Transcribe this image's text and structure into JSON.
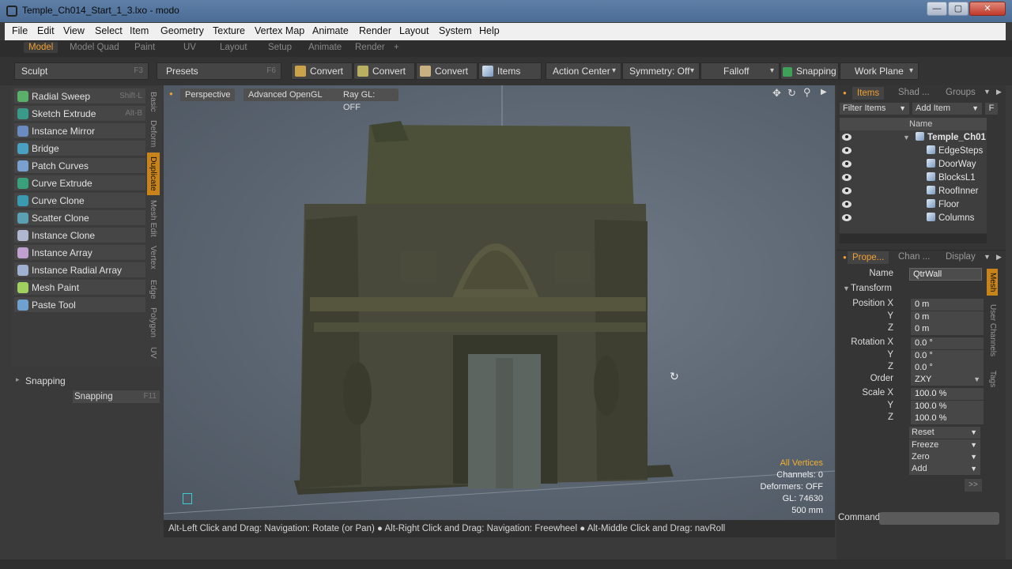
{
  "window": {
    "title": "Temple_Ch014_Start_1_3.lxo - modo",
    "minimize": "—",
    "maximize": "▢",
    "close": "✕"
  },
  "menu": [
    "File",
    "Edit",
    "View",
    "Select",
    "Item",
    "Geometry",
    "Texture",
    "Vertex Map",
    "Animate",
    "Render",
    "Layout",
    "System",
    "Help"
  ],
  "layout_tabs": [
    "Model",
    "Model Quad",
    "Paint",
    "UV",
    "Layout",
    "Setup",
    "Animate",
    "Render",
    "+"
  ],
  "toolbar": {
    "sculpt": {
      "label": "Sculpt",
      "shortcut": "F3"
    },
    "presets": {
      "label": "Presets",
      "shortcut": "F6"
    },
    "convert": [
      "Convert",
      "Convert",
      "Convert"
    ],
    "items": "Items",
    "action_center": "Action Center",
    "symmetry": "Symmetry: Off",
    "falloff": "Falloff",
    "snapping": "Snapping",
    "work_plane": "Work Plane"
  },
  "tools": [
    {
      "label": "Radial Sweep",
      "shortcut": "Shift-L"
    },
    {
      "label": "Sketch Extrude",
      "shortcut": "Alt-B"
    },
    {
      "label": "Instance Mirror",
      "shortcut": ""
    },
    {
      "label": "Bridge",
      "shortcut": ""
    },
    {
      "label": "Patch Curves",
      "shortcut": ""
    },
    {
      "label": "Curve Extrude",
      "shortcut": ""
    },
    {
      "label": "Curve Clone",
      "shortcut": ""
    },
    {
      "label": "Scatter Clone",
      "shortcut": ""
    },
    {
      "label": "Instance Clone",
      "shortcut": ""
    },
    {
      "label": "Instance Array",
      "shortcut": ""
    },
    {
      "label": "Instance Radial Array",
      "shortcut": ""
    },
    {
      "label": "Mesh Paint",
      "shortcut": ""
    },
    {
      "label": "Paste Tool",
      "shortcut": ""
    }
  ],
  "vertical_tabs": [
    "Basic",
    "Deform",
    "Duplicate",
    "Mesh Edit",
    "Vertex",
    "Edge",
    "Polygon",
    "UV"
  ],
  "snapping_section": {
    "title": "Snapping",
    "button": "Snapping",
    "shortcut": "F11"
  },
  "viewport": {
    "perspective": "Perspective",
    "renderer": "Advanced OpenGL",
    "raygl": "Ray GL: OFF",
    "info": {
      "mode": "All Vertices",
      "channels": "Channels: 0",
      "deformers": "Deformers: OFF",
      "gl": "GL: 74630",
      "scale": "500 mm"
    }
  },
  "status": "Alt-Left Click and Drag: Navigation: Rotate (or Pan) ● Alt-Right Click and Drag: Navigation: Freewheel ● Alt-Middle Click and Drag: navRoll",
  "items_panel": {
    "tabs": [
      "Items",
      "Shad ...",
      "Groups"
    ],
    "filter": "Filter Items",
    "add": "Add Item",
    "f": "F",
    "col_name": "Name",
    "root": "Temple_Ch01",
    "children": [
      "EdgeSteps",
      "DoorWay",
      "BlocksL1",
      "RoofInner",
      "Floor",
      "Columns"
    ]
  },
  "props_panel": {
    "tabs": [
      "Prope...",
      "Chan ...",
      "Display"
    ],
    "side_tabs": [
      "Mesh",
      "User Channels",
      "Tags"
    ],
    "name_label": "Name",
    "name_value": "QtrWall",
    "transform": "Transform",
    "position_label": "Position X",
    "position": [
      "0 m",
      "0 m",
      "0 m"
    ],
    "rotation_label": "Rotation X",
    "rotation": [
      "0.0 °",
      "0.0 °",
      "0.0 °"
    ],
    "order_label": "Order",
    "order": "ZXY",
    "scale_label": "Scale X",
    "scale": [
      "100.0 %",
      "100.0 %",
      "100.0 %"
    ],
    "y": "Y",
    "z": "Z",
    "buttons": [
      "Reset",
      "Freeze",
      "Zero",
      "Add"
    ],
    "more": ">>"
  },
  "command": {
    "label": "Command",
    "value": ""
  }
}
